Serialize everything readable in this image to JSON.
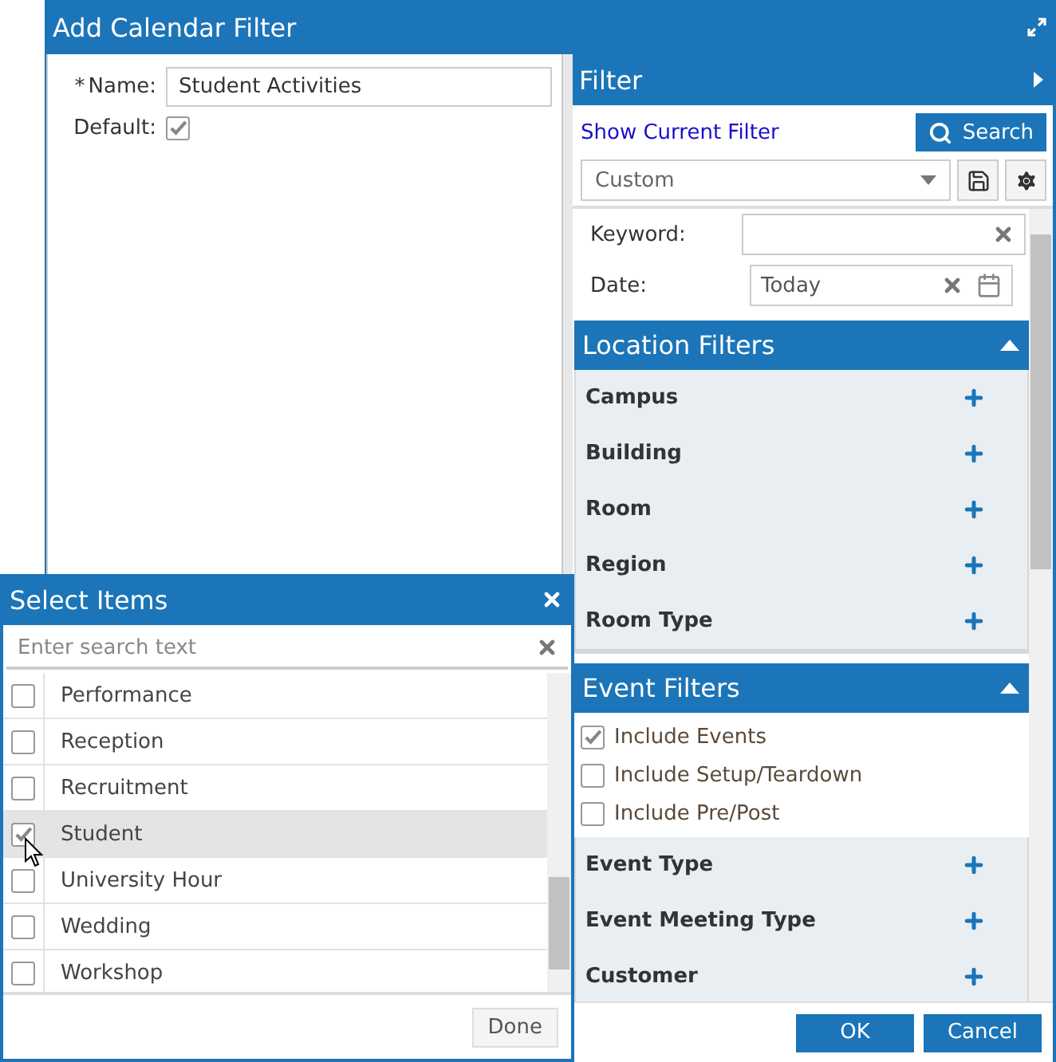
{
  "window": {
    "title": "Add Calendar Filter"
  },
  "form": {
    "required_mark": "*",
    "name_label": "Name:",
    "name_value": "Student Activities",
    "default_label": "Default:",
    "default_checked": true
  },
  "filter_panel": {
    "title": "Filter",
    "show_current_filter": "Show Current Filter",
    "search_button": "Search",
    "preset": "Custom",
    "keyword_label": "Keyword:",
    "date_label": "Date:",
    "date_value": "Today"
  },
  "sections": [
    {
      "title": "Location Filters",
      "expanded": true,
      "items": [
        "Campus",
        "Building",
        "Room",
        "Region",
        "Room Type"
      ]
    },
    {
      "title": "Event Filters",
      "expanded": true,
      "options": [
        {
          "label": "Include Events",
          "checked": true
        },
        {
          "label": "Include Setup/Teardown",
          "checked": false
        },
        {
          "label": "Include Pre/Post",
          "checked": false
        }
      ],
      "items": [
        "Event Type",
        "Event Meeting Type",
        "Customer"
      ]
    }
  ],
  "buttons": [
    "OK",
    "Cancel"
  ],
  "select_items": {
    "title": "Select Items",
    "search_placeholder": "Enter search text",
    "done_button": "Done",
    "items": [
      {
        "label": "Performance",
        "checked": false,
        "selected": false
      },
      {
        "label": "Reception",
        "checked": false,
        "selected": false
      },
      {
        "label": "Recruitment",
        "checked": false,
        "selected": false
      },
      {
        "label": "Student",
        "checked": true,
        "selected": true
      },
      {
        "label": "University Hour",
        "checked": false,
        "selected": false
      },
      {
        "label": "Wedding",
        "checked": false,
        "selected": false
      },
      {
        "label": "Workshop",
        "checked": false,
        "selected": false
      }
    ]
  }
}
